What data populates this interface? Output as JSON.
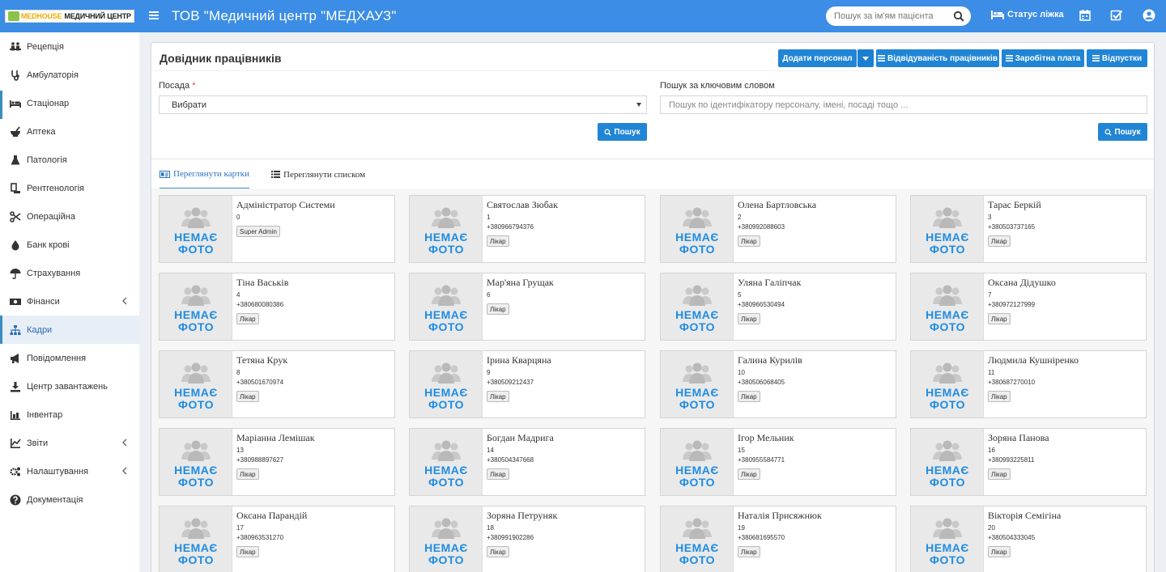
{
  "header": {
    "logo_a": "MEDHOUSE",
    "logo_b": "МЕДИЧНИЙ ЦЕНТР",
    "title": "ТОВ \"Медичний центр \"МЕДХАУЗ\"",
    "search_placeholder": "Пошук за ім'ям пацієнта",
    "bed_status": "Статус ліжка"
  },
  "sidebar": {
    "items": [
      {
        "label": "Рецепція",
        "icon": "reception-icon"
      },
      {
        "label": "Амбулаторія",
        "icon": "stethoscope-icon"
      },
      {
        "label": "Стаціонар",
        "icon": "bed-icon"
      },
      {
        "label": "Аптека",
        "icon": "mortar-icon"
      },
      {
        "label": "Патологія",
        "icon": "flask-icon"
      },
      {
        "label": "Рентгенологія",
        "icon": "xray-icon"
      },
      {
        "label": "Операційна",
        "icon": "scissors-icon"
      },
      {
        "label": "Банк крові",
        "icon": "drop-icon"
      },
      {
        "label": "Страхування",
        "icon": "umbrella-icon"
      },
      {
        "label": "Фінанси",
        "icon": "money-icon"
      },
      {
        "label": "Кадри",
        "icon": "sitemap-icon"
      },
      {
        "label": "Повідомлення",
        "icon": "bullhorn-icon"
      },
      {
        "label": "Центр завантажень",
        "icon": "download-icon"
      },
      {
        "label": "Інвентар",
        "icon": "inventory-icon"
      },
      {
        "label": "Звіти",
        "icon": "chart-icon"
      },
      {
        "label": "Налаштування",
        "icon": "cogs-icon"
      },
      {
        "label": "Документація",
        "icon": "question-icon"
      }
    ]
  },
  "page": {
    "title": "Довідник працівників",
    "add_staff": "Додати персонал",
    "attendance": "Відвідуваність працівників",
    "salary": "Заробітна плата",
    "vacations": "Відпустки",
    "position_label": "Посада",
    "position_required": "*",
    "position_value": "Вибрати",
    "keyword_label": "Пошук за ключовим словом",
    "keyword_placeholder": "Пошук по ідентифікатору персоналу, імені, посаді тощо ...",
    "search_btn": "Пошук",
    "tab_cards": "Переглянути картки",
    "tab_list": "Переглянути списком"
  },
  "no_photo": [
    "НЕМАЄ",
    "ФОТО"
  ],
  "staff": [
    {
      "name": "Адміністратор Системи",
      "id": "0",
      "phone": "",
      "role": "Super Admin"
    },
    {
      "name": "Святослав Зюбак",
      "id": "1",
      "phone": "+380966794376",
      "role": "Лікар"
    },
    {
      "name": "Олена Бартловська",
      "id": "2",
      "phone": "+380992088603",
      "role": "Лікар"
    },
    {
      "name": "Тарас Беркій",
      "id": "3",
      "phone": "+380503737165",
      "role": "Лікар"
    },
    {
      "name": "Тіна Васьків",
      "id": "4",
      "phone": "+380680080386",
      "role": "Лікар"
    },
    {
      "name": "Мар'яна Грущак",
      "id": "6",
      "phone": "",
      "role": "Лікар"
    },
    {
      "name": "Уляна Галіпчак",
      "id": "5",
      "phone": "+380966530494",
      "role": "Лікар"
    },
    {
      "name": "Оксана Дідушко",
      "id": "7",
      "phone": "+380972127999",
      "role": "Лікар"
    },
    {
      "name": "Тетяна Крук",
      "id": "8",
      "phone": "+380501670974",
      "role": "Лікар"
    },
    {
      "name": "Ірина Кварцяна",
      "id": "9",
      "phone": "+380509212437",
      "role": "Лікар"
    },
    {
      "name": "Галина Курилів",
      "id": "10",
      "phone": "+380506068405",
      "role": "Лікар"
    },
    {
      "name": "Людмила Кушніренко",
      "id": "11",
      "phone": "+380687270010",
      "role": "Лікар"
    },
    {
      "name": "Маріанна Лемішак",
      "id": "13",
      "phone": "+380988897627",
      "role": "Лікар"
    },
    {
      "name": "Богдан Мадрига",
      "id": "14",
      "phone": "+380504347668",
      "role": "Лікар"
    },
    {
      "name": "Ігор Мельник",
      "id": "15",
      "phone": "+380955584771",
      "role": "Лікар"
    },
    {
      "name": "Зоряна Панова",
      "id": "16",
      "phone": "+380993225811",
      "role": "Лікар"
    },
    {
      "name": "Оксана Парандій",
      "id": "17",
      "phone": "+380963531270",
      "role": "Лікар"
    },
    {
      "name": "Зоряна Петруняк",
      "id": "18",
      "phone": "+380991902286",
      "role": "Лікар"
    },
    {
      "name": "Наталія Присяжнюк",
      "id": "19",
      "phone": "+380681695570",
      "role": "Лікар"
    },
    {
      "name": "Вікторія Семігіна",
      "id": "20",
      "phone": "+380504333045",
      "role": "Лікар"
    }
  ],
  "colors": {
    "header": "#3b8de6",
    "accent": "#2185d5",
    "nophoto": "#1e8ce3"
  }
}
